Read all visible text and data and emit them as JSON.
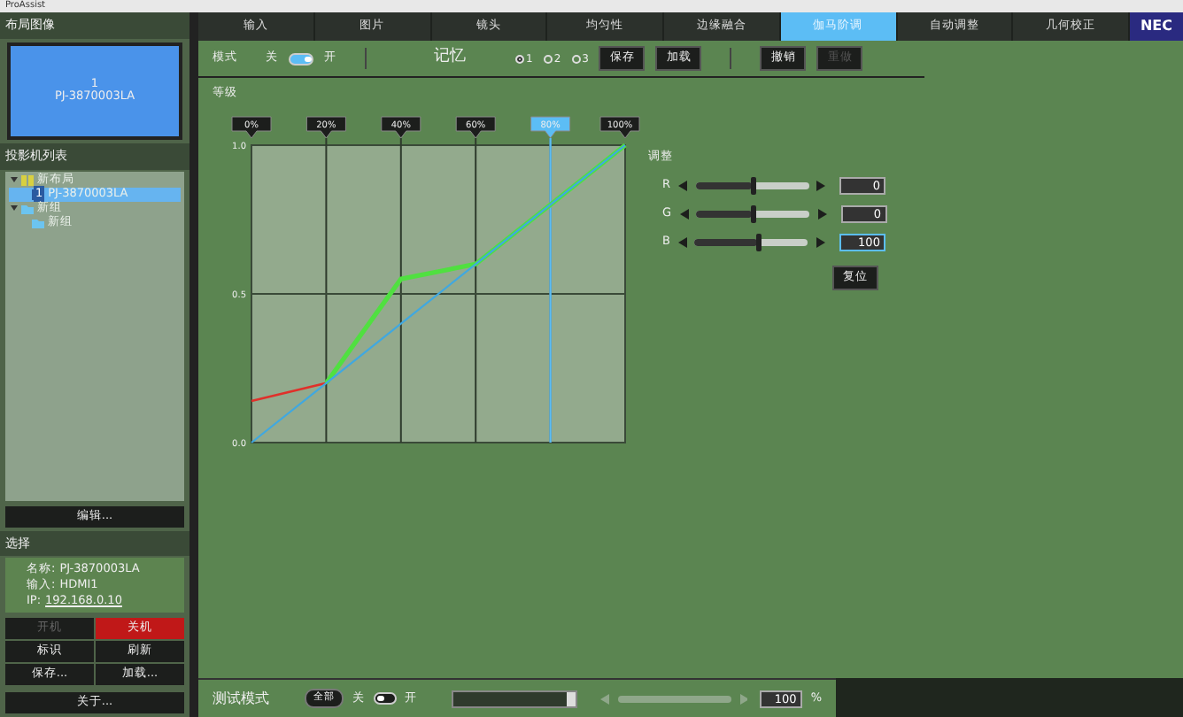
{
  "window": {
    "title": "ProAssist"
  },
  "sidebar": {
    "layout_title": "布局图像",
    "preview": {
      "number": "1",
      "name": "PJ-3870003LA"
    },
    "list_title": "投影机列表",
    "tree": [
      {
        "label": "新布局",
        "kind": "layout",
        "selected": false,
        "children": [
          {
            "label": "PJ-3870003LA",
            "number": "1",
            "kind": "projector",
            "selected": true
          }
        ]
      },
      {
        "label": "新组",
        "kind": "group",
        "selected": false,
        "children": [
          {
            "label": "新组",
            "kind": "group",
            "selected": false
          }
        ]
      }
    ],
    "edit_button": "编辑...",
    "select_title": "选择",
    "info": [
      {
        "label": "名称:",
        "value": "PJ-3870003LA",
        "link": false
      },
      {
        "label": "输入:",
        "value": "HDMI1",
        "link": false
      },
      {
        "label": "IP:",
        "value": "192.168.0.10",
        "link": true
      }
    ],
    "buttons": [
      {
        "label": "开机",
        "kind": "normal",
        "disabled": true
      },
      {
        "label": "关机",
        "kind": "danger",
        "disabled": false
      },
      {
        "label": "标识",
        "kind": "normal",
        "disabled": false
      },
      {
        "label": "刷新",
        "kind": "normal",
        "disabled": false
      },
      {
        "label": "保存...",
        "kind": "normal",
        "disabled": false
      },
      {
        "label": "加载...",
        "kind": "normal",
        "disabled": false
      }
    ],
    "about_button": "关于..."
  },
  "tabs": [
    {
      "label": "输入",
      "selected": false
    },
    {
      "label": "图片",
      "selected": false
    },
    {
      "label": "镜头",
      "selected": false
    },
    {
      "label": "均匀性",
      "selected": false
    },
    {
      "label": "边缘融合",
      "selected": false
    },
    {
      "label": "伽马阶调",
      "selected": true
    },
    {
      "label": "自动调整",
      "selected": false
    },
    {
      "label": "几何校正",
      "selected": false
    }
  ],
  "logo": "NEC",
  "toolbar": {
    "mode_label": "模式",
    "off_label": "关",
    "mode_on": true,
    "on_label": "开",
    "memory_label": "记忆",
    "memories": [
      {
        "label": "1",
        "selected": true
      },
      {
        "label": "2",
        "selected": false
      },
      {
        "label": "3",
        "selected": false
      }
    ],
    "buttons": [
      {
        "label": "保存",
        "disabled": false
      },
      {
        "label": "加载",
        "disabled": false
      }
    ],
    "history_buttons": [
      {
        "label": "撤销",
        "disabled": false
      },
      {
        "label": "重做",
        "disabled": true
      }
    ]
  },
  "gamma": {
    "title": "等级",
    "handles": [
      {
        "selected": false
      },
      {
        "selected": false
      },
      {
        "selected": false
      },
      {
        "selected": false
      },
      {
        "selected": true
      },
      {
        "selected": false
      }
    ],
    "chart_data": {
      "type": "line",
      "grid": true,
      "ref_lines": [
        {
          "axis": "y",
          "value": 0.5,
          "color": "#3a4a38"
        },
        {
          "axis": "x",
          "value": "80%",
          "color": "#5cbdf5"
        }
      ],
      "categories": [
        "0%",
        "20%",
        "40%",
        "60%",
        "80%",
        "100%"
      ],
      "ylim": [
        0,
        1
      ],
      "yticks": [
        {
          "value": 0,
          "label": "0.0"
        },
        {
          "value": 0.5,
          "label": "0.5"
        },
        {
          "value": 1,
          "label": "1.0"
        }
      ],
      "series": [
        {
          "color": "#e0302a",
          "values": [
            0.14,
            0.2,
            null,
            null,
            null,
            null
          ]
        },
        {
          "color": "#50e040",
          "values": [
            null,
            0.2,
            0.55,
            0.6,
            0.8,
            1.0
          ]
        },
        {
          "color": "#40a8e0",
          "values": [
            0.0,
            0.2,
            0.4,
            0.6,
            0.8,
            1.0
          ]
        }
      ]
    }
  },
  "adjust": {
    "title": "调整",
    "channels": [
      {
        "name": "R",
        "level": 0.5,
        "value": "0",
        "focused": false
      },
      {
        "name": "G",
        "level": 0.5,
        "value": "0",
        "focused": false
      },
      {
        "name": "B",
        "level": 0.55,
        "value": "100",
        "focused": true
      }
    ],
    "reset_button": "复位"
  },
  "test_bar": {
    "title": "测试模式",
    "all_label": "全部",
    "off_label": "关",
    "on": false,
    "on_label": "开",
    "slider_disabled": true,
    "value": "100",
    "unit": "%"
  }
}
